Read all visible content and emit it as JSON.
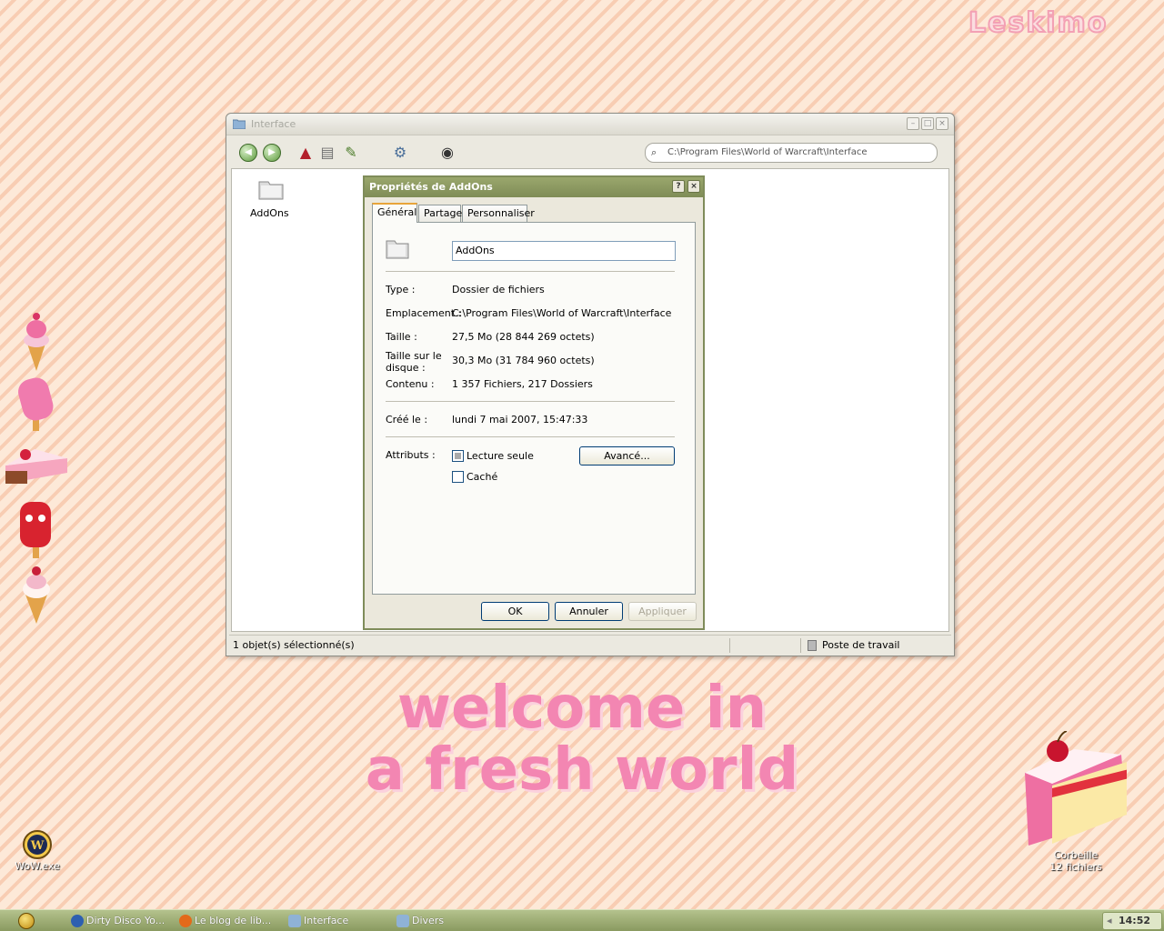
{
  "desktop": {
    "brand": "Leskimo",
    "welcome_line1": "welcome in",
    "welcome_line2": "a fresh world",
    "wow_icon_label": "WoW.exe",
    "trash_label": "Corbeille",
    "trash_count": "12 fichiers"
  },
  "window": {
    "title": "Interface",
    "address": "C:\\Program Files\\World of Warcraft\\Interface",
    "folder_item": "AddOns",
    "status_selected": "1 objet(s) sélectionné(s)",
    "status_location": "Poste de travail"
  },
  "dialog": {
    "title": "Propriétés de AddOns",
    "tabs": [
      "Général",
      "Partage",
      "Personnaliser"
    ],
    "name_value": "AddOns",
    "type_label": "Type :",
    "type_value": "Dossier de fichiers",
    "location_label": "Emplacement :",
    "location_value": "C:\\Program Files\\World of Warcraft\\Interface",
    "size_label": "Taille :",
    "size_value": "27,5 Mo (28 844 269 octets)",
    "disk_size_label_1": "Taille sur le",
    "disk_size_label_2": "disque :",
    "disk_size_value": "30,3 Mo (31 784 960 octets)",
    "content_label": "Contenu :",
    "content_value": "1 357 Fichiers, 217 Dossiers",
    "created_label": "Créé le :",
    "created_value": "lundi 7 mai 2007, 15:47:33",
    "attributes_label": "Attributs :",
    "readonly_label": "Lecture seule",
    "hidden_label": "Caché",
    "advanced_button": "Avancé...",
    "ok_button": "OK",
    "cancel_button": "Annuler",
    "apply_button": "Appliquer"
  },
  "taskbar": {
    "items": [
      "Dirty Disco Yo...",
      "Le blog de lib...",
      "Interface",
      "Divers"
    ],
    "clock": "14:52"
  }
}
